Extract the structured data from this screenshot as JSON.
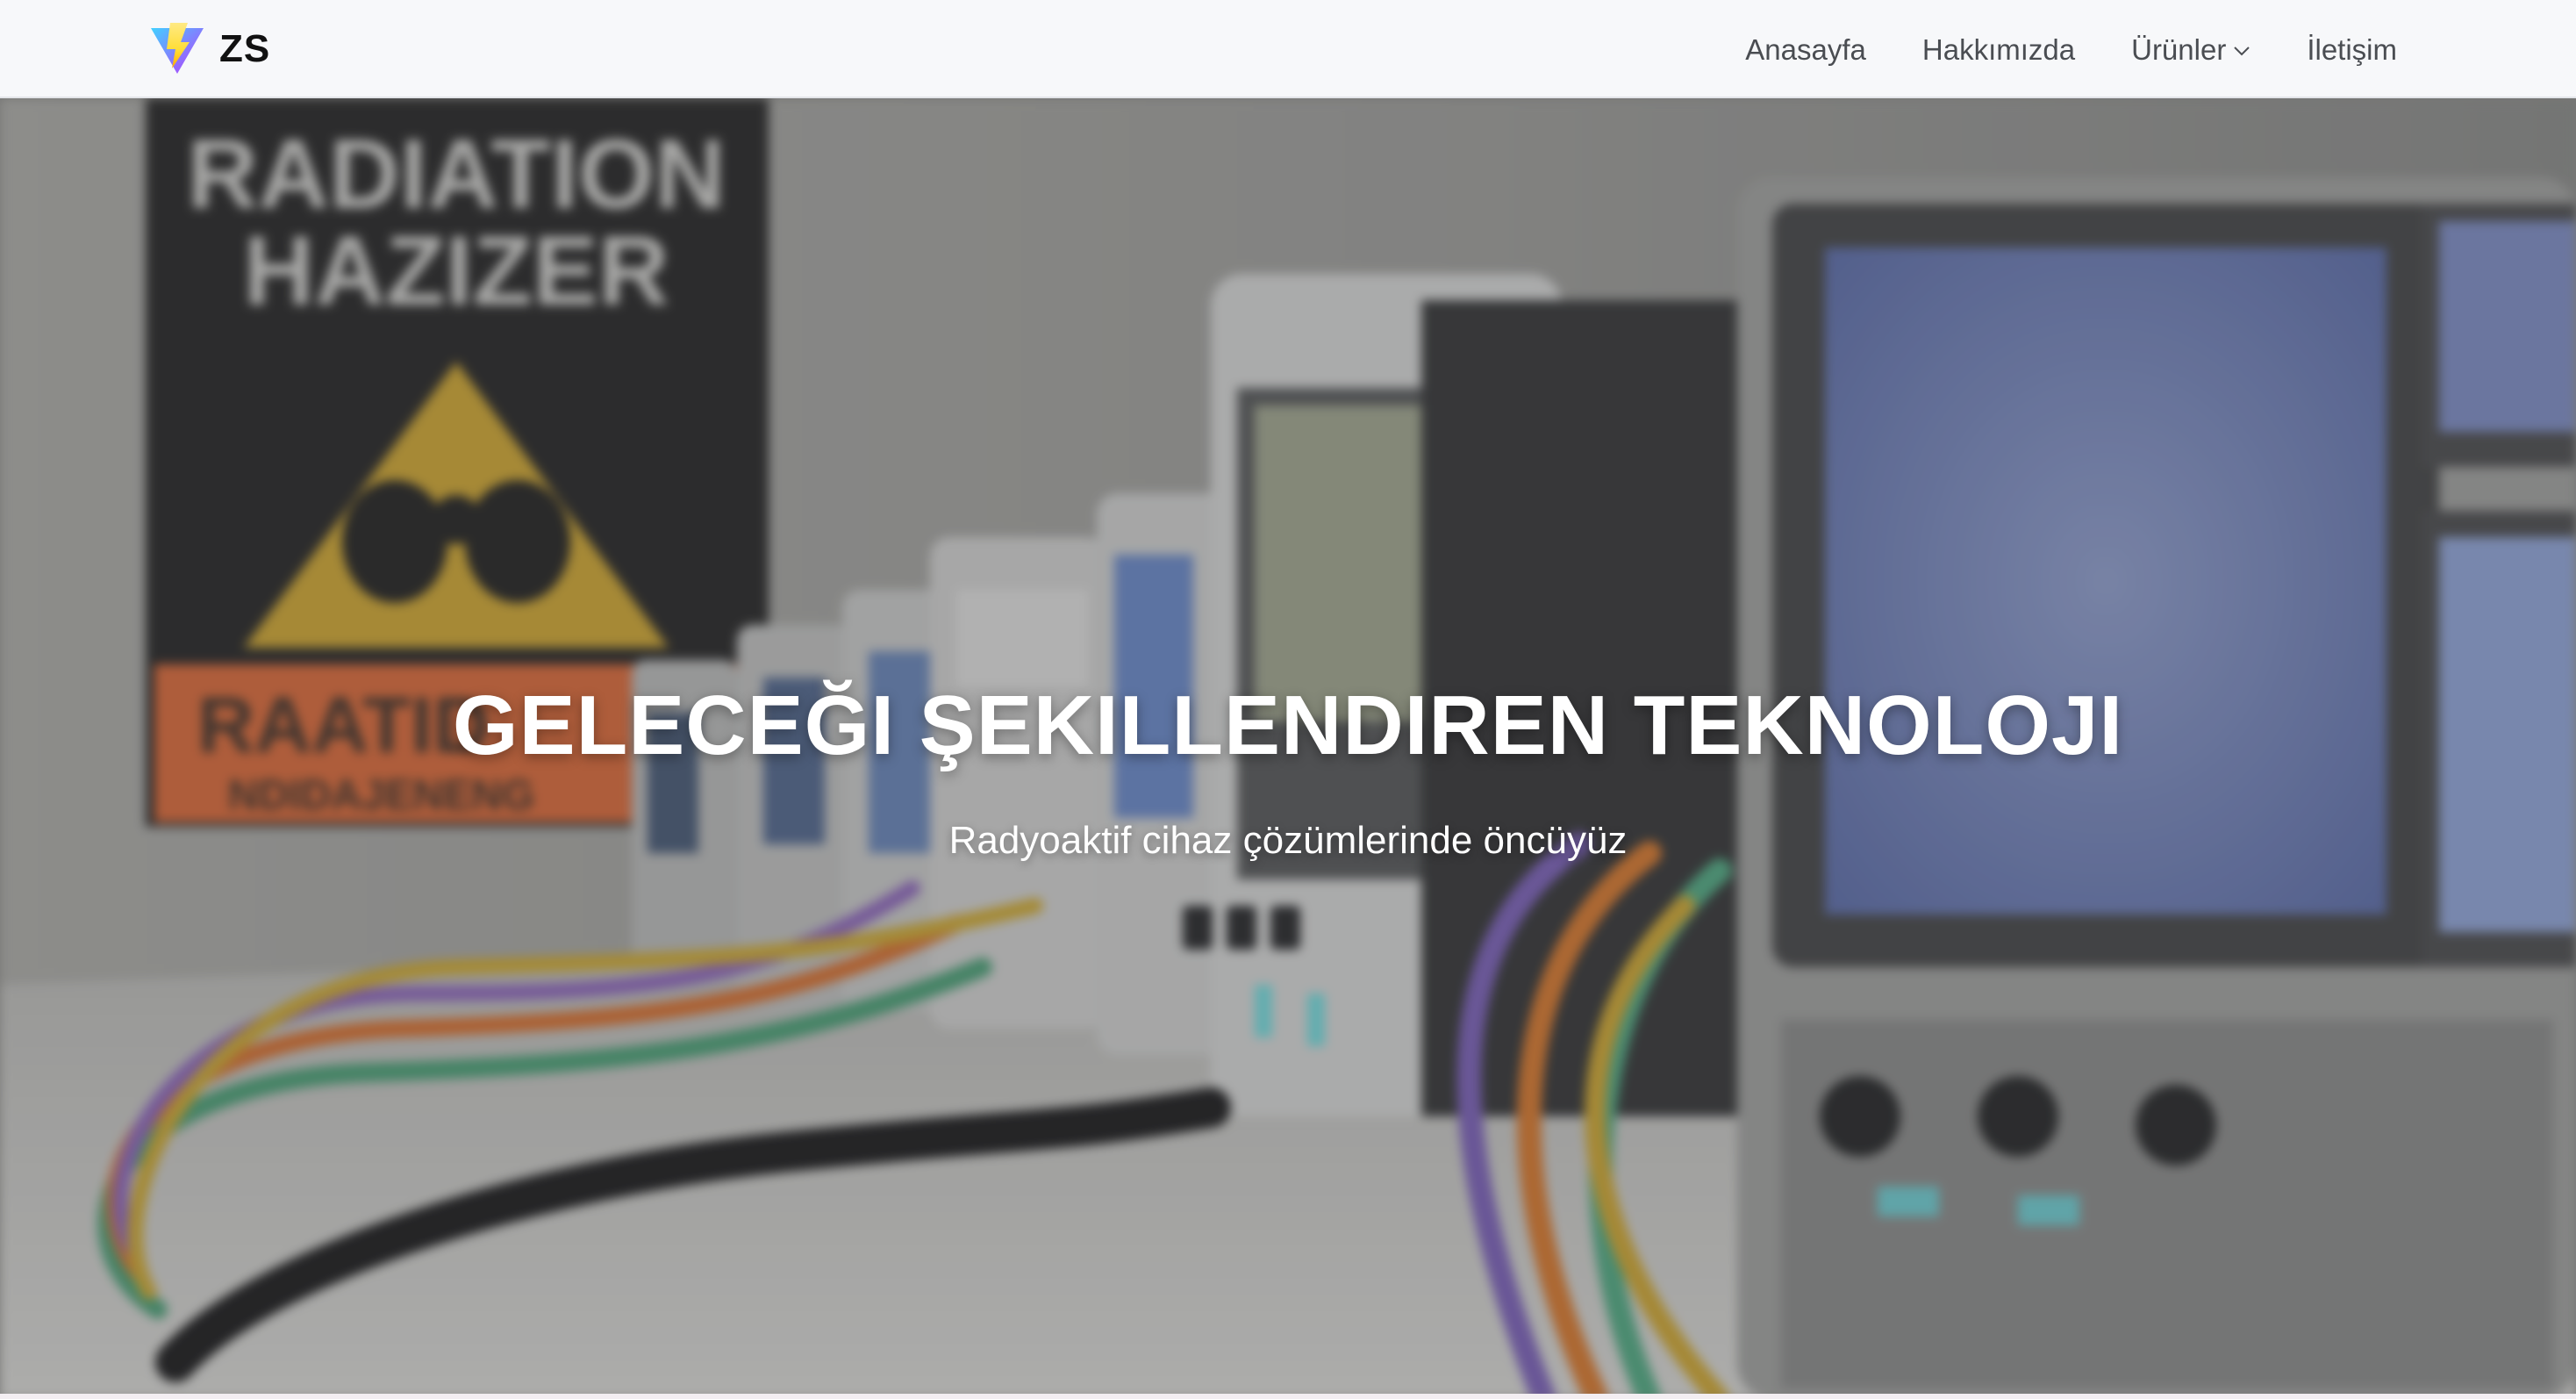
{
  "navbar": {
    "brand_name": "ZS",
    "links": [
      {
        "label": "Anasayfa"
      },
      {
        "label": "Hakkımızda"
      },
      {
        "label": "Ürünler"
      },
      {
        "label": "İletişim"
      }
    ]
  },
  "hero": {
    "title": "GELECEĞI ŞEKILLENDIREN TEKNOLOJI",
    "subtitle": "Radyoaktif cihaz çözümlerinde öncüyüz",
    "sign": {
      "line1": "RADIATION",
      "line2": "HAZIZER",
      "bottom1": "RAATID",
      "bottom2": "NDIDAJENENG"
    }
  },
  "colors": {
    "navbar_bg": "#f7f8fa",
    "nav_text": "#4a4d52",
    "hero_text": "#ffffff",
    "logo_purple": "#8b5cf6",
    "logo_yellow": "#f5c518"
  },
  "icons": [
    "lightning-logo-icon",
    "chevron-down-icon"
  ]
}
